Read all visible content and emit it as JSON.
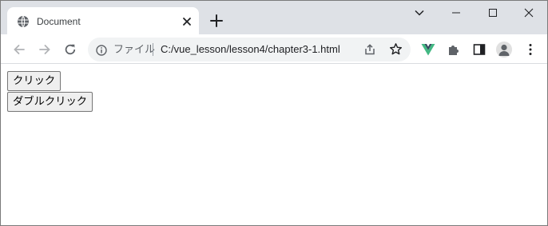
{
  "tab": {
    "title": "Document",
    "favicon_icon": "globe-icon",
    "close_icon": "close-icon"
  },
  "newtab": {
    "icon": "plus-icon"
  },
  "window_controls": {
    "tabsearch_icon": "chevron-down-icon",
    "minimize_icon": "minimize-icon",
    "maximize_icon": "maximize-icon",
    "close_icon": "close-icon"
  },
  "toolbar": {
    "back_icon": "arrow-left-icon",
    "forward_icon": "arrow-right-icon",
    "reload_icon": "reload-icon"
  },
  "omnibox": {
    "scheme_label": "ファイル",
    "url": "C:/vue_lesson/lesson4/chapter3-1.html",
    "info_icon": "info-icon",
    "share_icon": "share-icon",
    "bookmark_icon": "star-icon"
  },
  "extensions": {
    "vue_devtools_icon": "vue-logo-icon",
    "extensions_icon": "puzzle-icon",
    "sidepanel_icon": "side-panel-icon",
    "profile_icon": "avatar-icon",
    "menu_icon": "kebab-menu-icon",
    "vue_color": "#42b883"
  },
  "page": {
    "click_button": "クリック",
    "dblclick_button": "ダブルクリック"
  },
  "colors": {
    "tabstrip": "#dee1e6",
    "omnibox": "#f1f3f4",
    "icon": "#5f6368"
  }
}
